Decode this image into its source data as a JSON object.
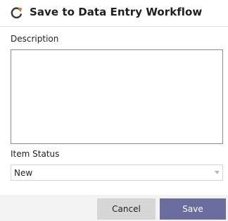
{
  "dialog": {
    "title": "Save to Data Entry Workflow",
    "header_icon": "refresh-icon"
  },
  "description": {
    "label": "Description",
    "value": ""
  },
  "item_status": {
    "label": "Item Status",
    "selected": "New",
    "icon": "chevron-down-icon"
  },
  "buttons": {
    "cancel_label": "Cancel",
    "save_label": "Save"
  },
  "colors": {
    "save_button": "#6a6d9d",
    "cancel_button": "#d6d6d6",
    "footer_background": "#f3f3f3",
    "icon": "#3a3a3a",
    "icon_accent": "#e0701e"
  }
}
